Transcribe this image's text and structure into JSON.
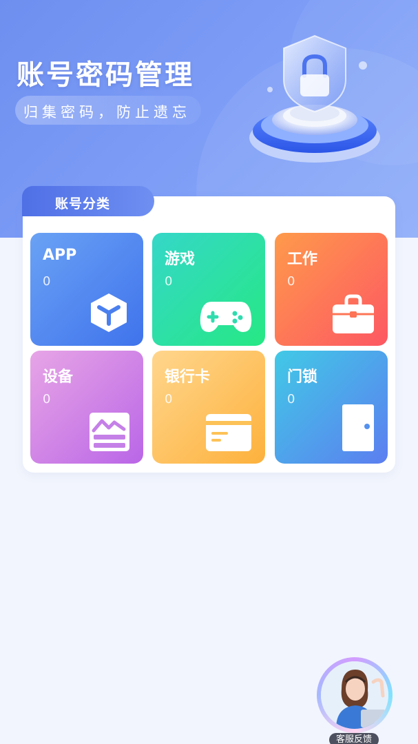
{
  "header": {
    "title": "账号密码管理",
    "subtitle": "归集密码，防止遗忘"
  },
  "section": {
    "tab_label": "账号分类"
  },
  "categories": [
    {
      "label": "APP",
      "count": "0",
      "icon": "cube-icon"
    },
    {
      "label": "游戏",
      "count": "0",
      "icon": "gamepad-icon"
    },
    {
      "label": "工作",
      "count": "0",
      "icon": "briefcase-icon"
    },
    {
      "label": "设备",
      "count": "0",
      "icon": "monitor-chart-icon"
    },
    {
      "label": "银行卡",
      "count": "0",
      "icon": "bank-card-icon"
    },
    {
      "label": "门锁",
      "count": "0",
      "icon": "door-icon"
    }
  ],
  "support": {
    "label": "客服反馈"
  },
  "colors": {
    "header_gradient_start": "#6f8ff0",
    "header_gradient_end": "#8eadf9",
    "tab_blue": "#4f6fe6",
    "page_background": "#f2f5fd"
  }
}
